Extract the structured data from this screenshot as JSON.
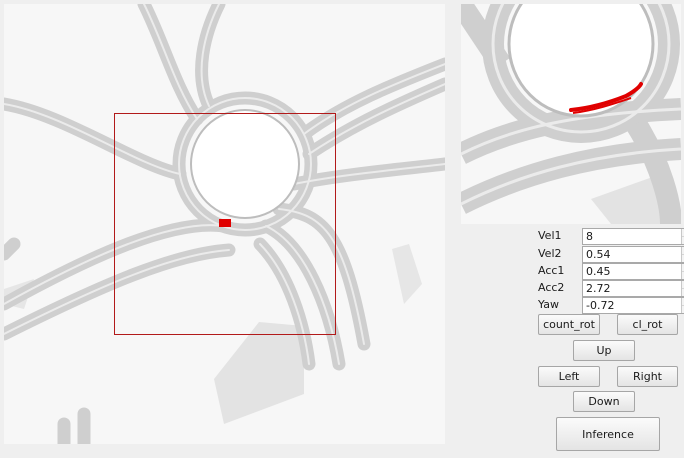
{
  "params": [
    {
      "label": "Vel1",
      "value": "8"
    },
    {
      "label": "Vel2",
      "value": "0.54"
    },
    {
      "label": "Acc1",
      "value": "0.45"
    },
    {
      "label": "Acc2",
      "value": "2.72"
    },
    {
      "label": "Yaw",
      "value": "-0.72"
    }
  ],
  "buttons": {
    "count_rot": "count_rot",
    "cl_rot": "cl_rot",
    "up": "Up",
    "left": "Left",
    "right": "Right",
    "down": "Down",
    "inference": "Inference"
  },
  "colors": {
    "road": "#d3d3d3",
    "road_lane": "#bdbdbd",
    "map_background": "#f7f7f7",
    "selection_box": "#b21a1a",
    "vehicle": "#e00000",
    "trajectory": "#e00000"
  }
}
